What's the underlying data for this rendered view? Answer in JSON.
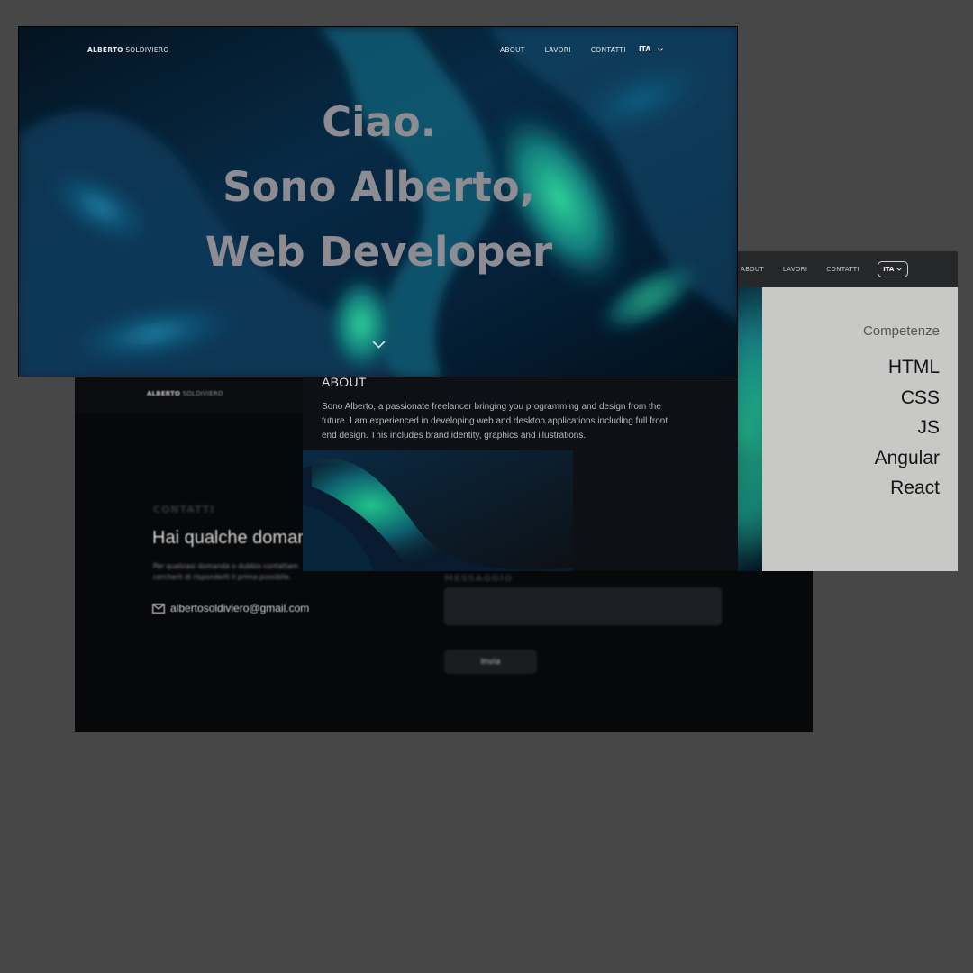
{
  "back_page": {
    "brand_first": "ALBERTO",
    "brand_last": " SOLDIVIERO",
    "contact_eyebrow": "CONTATTI",
    "contact_title": "Hai qualche doman",
    "contact_desc": "Per qualsiasi domanda o dubbio contattam cercherò di risponderti il prima possibile.",
    "contact_email": "albertosoldiviero@gmail.com",
    "message_label": "MESSAGGIO",
    "send_label": "Invia"
  },
  "about": {
    "title": "ABOUT",
    "text": "Sono Alberto, a passionate freelancer bringing you programming and design from the future. I am experienced in developing web and desktop applications including full front end design. This includes brand identity, graphics and illustrations."
  },
  "side_card": {
    "nav": [
      "ABOUT",
      "LAVORI",
      "CONTATTI"
    ],
    "lang": "ITA",
    "skills_heading": "Competenze",
    "skills": [
      "HTML",
      "CSS",
      "JS",
      "Angular",
      "React"
    ]
  },
  "hero": {
    "brand_first": "ALBERTO",
    "brand_last": " SOLDIVIERO",
    "nav": [
      "ABOUT",
      "LAVORI",
      "CONTATTI"
    ],
    "lang": "ITA",
    "title_lines": [
      "Ciao.",
      "Sono Alberto,",
      "Web Developer"
    ]
  },
  "colors": {
    "page_bg": "#474747",
    "hero_title": "#8c8c92",
    "skills_bg": "#c8c9c7",
    "accent_green": "#2fd39a"
  }
}
